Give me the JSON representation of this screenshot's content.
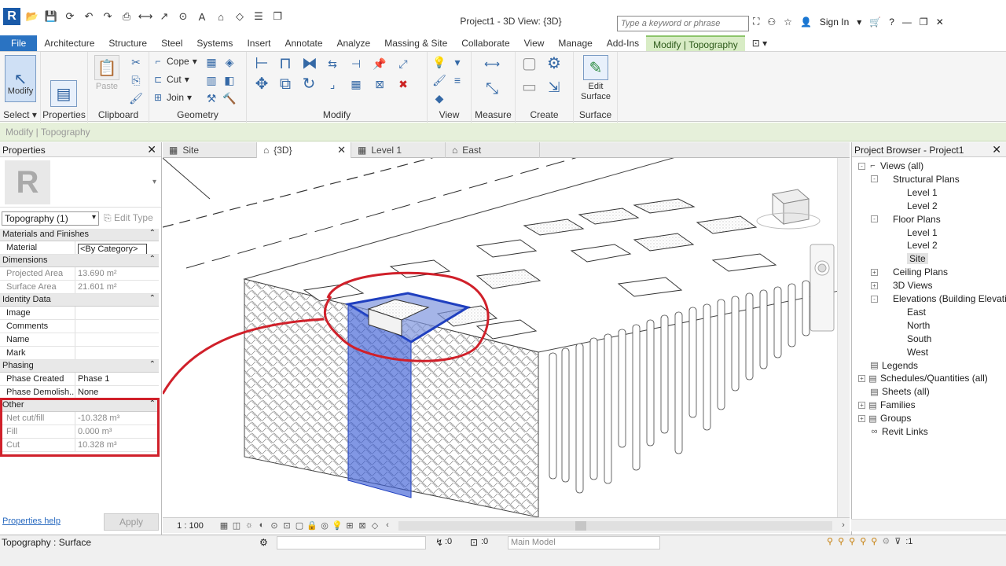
{
  "app": {
    "title": "Project1 - 3D View: {3D}",
    "search_placeholder": "Type a keyword or phrase",
    "sign_in": "Sign In"
  },
  "ribbon_tabs": [
    "File",
    "Architecture",
    "Structure",
    "Steel",
    "Systems",
    "Insert",
    "Annotate",
    "Analyze",
    "Massing & Site",
    "Collaborate",
    "View",
    "Manage",
    "Add-Ins",
    "Modify | Topography"
  ],
  "ribbon": {
    "modify_label": "Modify",
    "properties_label": "Properties",
    "paste_label": "Paste",
    "cope_label": "Cope",
    "cut_label": "Cut",
    "join_label": "Join",
    "edit_surface_label": "Edit Surface",
    "panels": {
      "select": "Select",
      "properties": "Properties",
      "clipboard": "Clipboard",
      "geometry": "Geometry",
      "modify": "Modify",
      "view": "View",
      "measure": "Measure",
      "create": "Create",
      "surface": "Surface"
    }
  },
  "mode_bar": "Modify | Topography",
  "properties": {
    "header": "Properties",
    "type_selector": "Topography (1)",
    "edit_type": "Edit Type",
    "groups": [
      {
        "name": "Materials and Finishes",
        "rows": [
          {
            "k": "Material",
            "v": "<By Category>",
            "ro": false
          }
        ]
      },
      {
        "name": "Dimensions",
        "rows": [
          {
            "k": "Projected Area",
            "v": "13.690 m²",
            "ro": true
          },
          {
            "k": "Surface Area",
            "v": "21.601 m²",
            "ro": true
          }
        ]
      },
      {
        "name": "Identity Data",
        "rows": [
          {
            "k": "Image",
            "v": "",
            "ro": false
          },
          {
            "k": "Comments",
            "v": "",
            "ro": false
          },
          {
            "k": "Name",
            "v": "",
            "ro": false
          },
          {
            "k": "Mark",
            "v": "",
            "ro": false
          }
        ]
      },
      {
        "name": "Phasing",
        "rows": [
          {
            "k": "Phase Created",
            "v": "Phase 1",
            "ro": false
          },
          {
            "k": "Phase Demolish...",
            "v": "None",
            "ro": false
          }
        ]
      },
      {
        "name": "Other",
        "rows": [
          {
            "k": "Net cut/fill",
            "v": "-10.328 m³",
            "ro": true
          },
          {
            "k": "Fill",
            "v": "0.000 m³",
            "ro": true
          },
          {
            "k": "Cut",
            "v": "10.328 m³",
            "ro": true
          }
        ]
      }
    ],
    "help_link": "Properties help",
    "apply": "Apply"
  },
  "view_tabs": [
    "Site",
    "{3D}",
    "Level 1",
    "East"
  ],
  "view_scale": "1 : 100",
  "browser": {
    "header": "Project Browser - Project1",
    "nodes": [
      {
        "label": "Views (all)",
        "depth": 0,
        "toggle": "-"
      },
      {
        "label": "Structural Plans",
        "depth": 1,
        "toggle": "-"
      },
      {
        "label": "Level 1",
        "depth": 2,
        "toggle": ""
      },
      {
        "label": "Level 2",
        "depth": 2,
        "toggle": ""
      },
      {
        "label": "Floor Plans",
        "depth": 1,
        "toggle": "-"
      },
      {
        "label": "Level 1",
        "depth": 2,
        "toggle": ""
      },
      {
        "label": "Level 2",
        "depth": 2,
        "toggle": ""
      },
      {
        "label": "Site",
        "depth": 2,
        "toggle": "",
        "selected": true
      },
      {
        "label": "Ceiling Plans",
        "depth": 1,
        "toggle": "+"
      },
      {
        "label": "3D Views",
        "depth": 1,
        "toggle": "+"
      },
      {
        "label": "Elevations (Building Elevation)",
        "depth": 1,
        "toggle": "-"
      },
      {
        "label": "East",
        "depth": 2,
        "toggle": ""
      },
      {
        "label": "North",
        "depth": 2,
        "toggle": ""
      },
      {
        "label": "South",
        "depth": 2,
        "toggle": ""
      },
      {
        "label": "West",
        "depth": 2,
        "toggle": ""
      },
      {
        "label": "Legends",
        "depth": 0,
        "toggle": ""
      },
      {
        "label": "Schedules/Quantities (all)",
        "depth": 0,
        "toggle": "+"
      },
      {
        "label": "Sheets (all)",
        "depth": 0,
        "toggle": ""
      },
      {
        "label": "Families",
        "depth": 0,
        "toggle": "+"
      },
      {
        "label": "Groups",
        "depth": 0,
        "toggle": "+"
      },
      {
        "label": "Revit Links",
        "depth": 0,
        "toggle": ""
      }
    ]
  },
  "status": {
    "text": "Topography : Surface",
    "workset_value": ":0",
    "model": "Main Model",
    "filter_count": ":1"
  },
  "colors": {
    "file_tab": "#2a73c2",
    "context_tab": "#d8ecc5",
    "highlight_red": "#d0202a",
    "selection_blue": "#2b4fc8"
  }
}
